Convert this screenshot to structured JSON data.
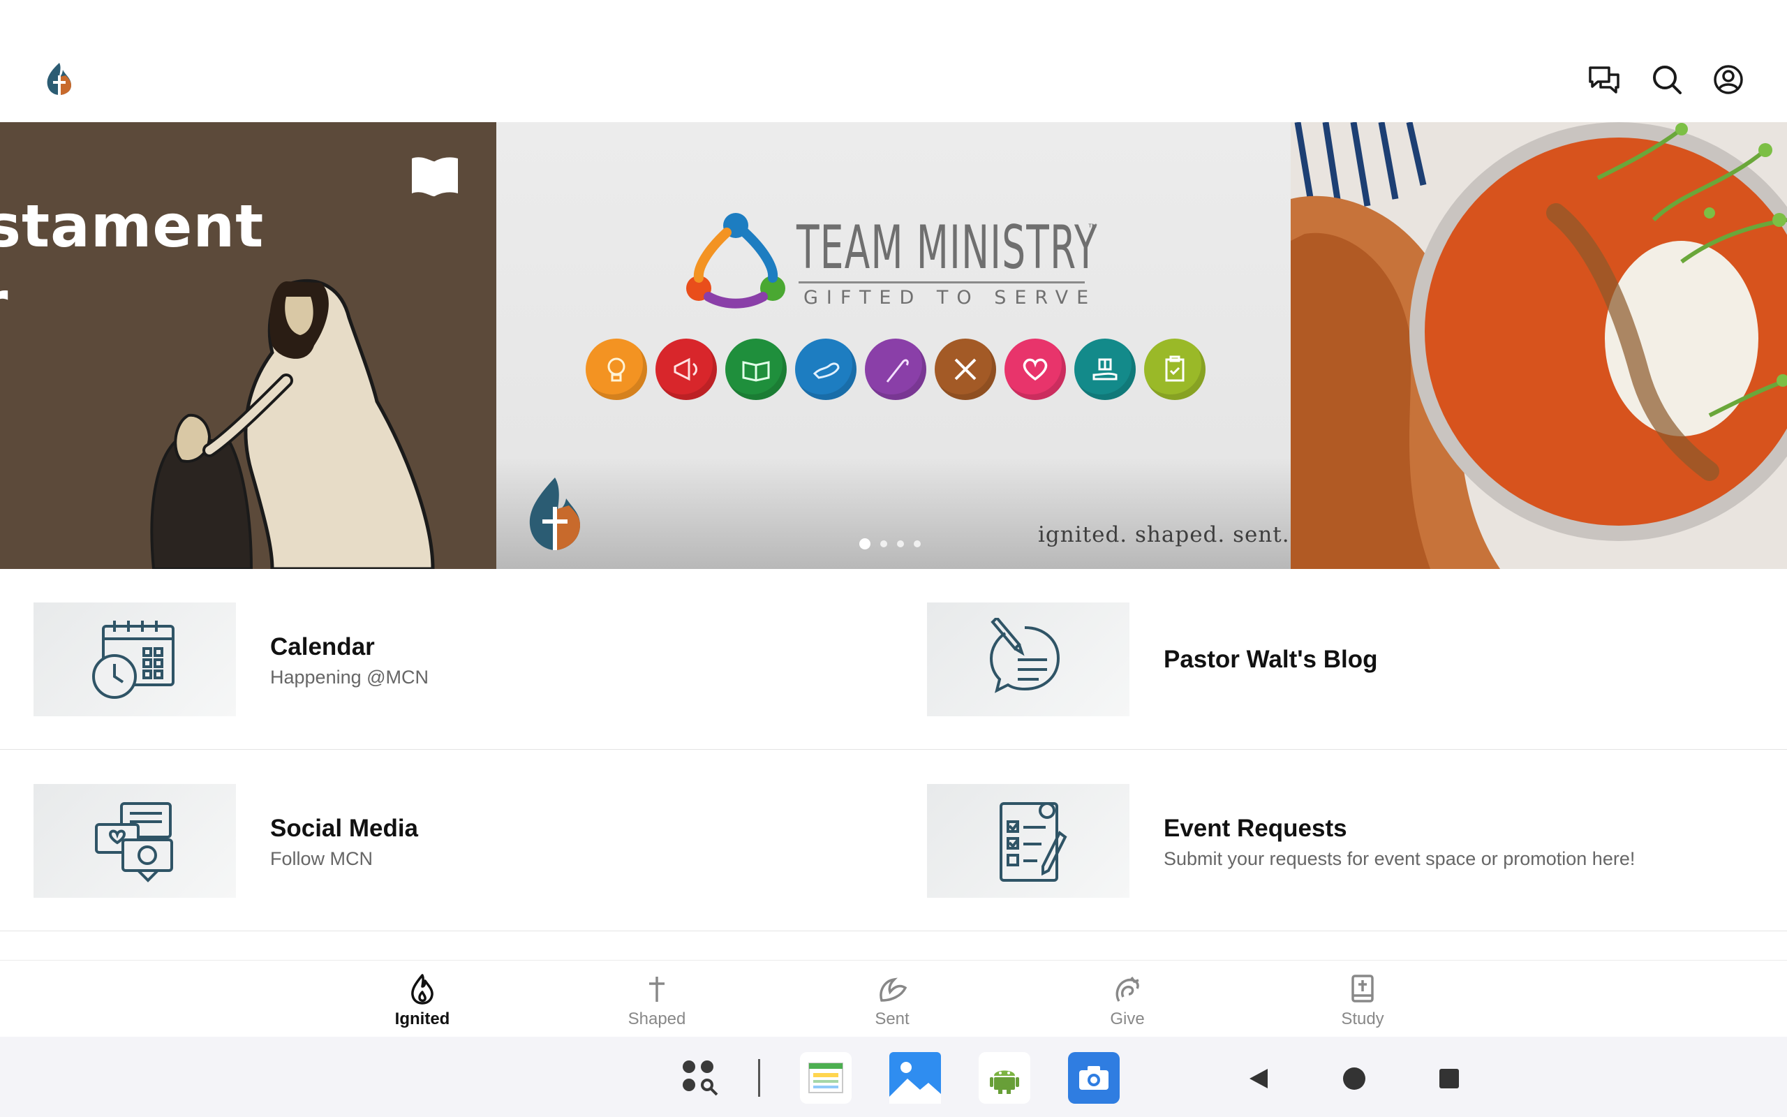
{
  "top_bar": {
    "icons": [
      "church-logo-icon",
      "chat-icon",
      "search-icon",
      "account-icon"
    ]
  },
  "carousel": {
    "left_slide": {
      "text_line1": "stament",
      "text_line2": "r"
    },
    "center_slide": {
      "title": "TEAM MINISTRY",
      "trademark": "™",
      "subtitle": "GIFTED TO SERVE",
      "tagline": "ignited. shaped. sent.",
      "gift_colors": [
        "#f39322",
        "#d8262b",
        "#1f8f3c",
        "#1d7dc1",
        "#8a3fa8",
        "#a35a26",
        "#e8346b",
        "#138a8a",
        "#9ab928"
      ],
      "gift_icons": [
        "lightbulb-icon",
        "megaphone-icon",
        "book-icon",
        "hands-icon",
        "staff-icon",
        "tools-icon",
        "heart-icon",
        "gift-hand-icon",
        "clipboard-icon"
      ]
    },
    "active_page": 1,
    "page_count": 4
  },
  "cards": [
    {
      "title": "Calendar",
      "subtitle": "Happening @MCN",
      "icon": "calendar-clock-icon"
    },
    {
      "title": "Pastor Walt's Blog",
      "subtitle": "",
      "icon": "blog-pencil-icon"
    },
    {
      "title": "Social Media",
      "subtitle": "Follow MCN",
      "icon": "social-chat-icon"
    },
    {
      "title": "Event Requests",
      "subtitle": "Submit your requests for event space or promotion here!",
      "icon": "checklist-icon"
    }
  ],
  "bottom_nav": {
    "items": [
      {
        "label": "Ignited",
        "icon": "flame-icon",
        "active": true
      },
      {
        "label": "Shaped",
        "icon": "cross-icon",
        "active": false
      },
      {
        "label": "Sent",
        "icon": "leaf-icon",
        "active": false
      },
      {
        "label": "Give",
        "icon": "give-icon",
        "active": false
      },
      {
        "label": "Study",
        "icon": "bible-icon",
        "active": false
      }
    ]
  },
  "system_bar": {
    "apps": [
      "app-drawer-icon",
      "sheets-app-icon",
      "gallery-app-icon",
      "android-app-icon",
      "camera-app-icon"
    ],
    "nav": [
      "back-icon",
      "home-icon",
      "recents-icon"
    ]
  },
  "colors": {
    "accent_blue": "#1d7dc1",
    "dark_icon": "#1d3a4d",
    "active_text": "#111111",
    "inactive_text": "#888888"
  }
}
